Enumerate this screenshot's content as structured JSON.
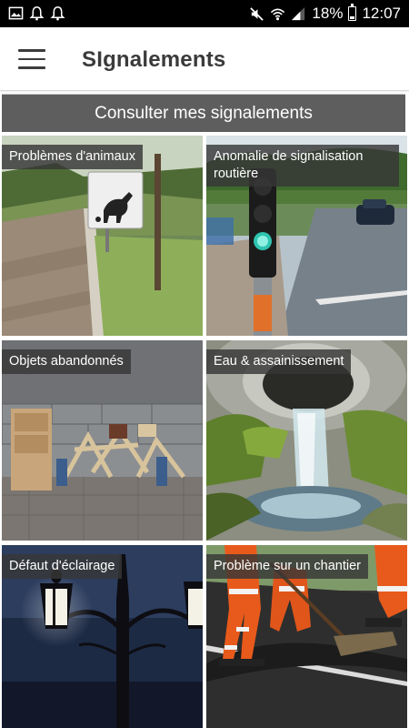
{
  "status_bar": {
    "battery": "18%",
    "time": "12:07",
    "left_icons": [
      "image-icon",
      "bell-icon",
      "bell-outline-icon"
    ],
    "right_icons": [
      "mute-icon",
      "wifi-icon",
      "signal-icon",
      "battery-icon"
    ]
  },
  "app_bar": {
    "title": "SIgnalements",
    "menu_icon": "hamburger-menu-icon"
  },
  "consult_button": {
    "label": "Consulter mes signalements",
    "color": "#5e5e5e"
  },
  "categories": [
    {
      "label": "Problèmes d'animaux"
    },
    {
      "label": "Anomalie de signalisation routière"
    },
    {
      "label": "Objets abandonnés"
    },
    {
      "label": "Eau & assainissement"
    },
    {
      "label": "Défaut d'éclairage"
    },
    {
      "label": "Problème sur un chantier"
    }
  ]
}
